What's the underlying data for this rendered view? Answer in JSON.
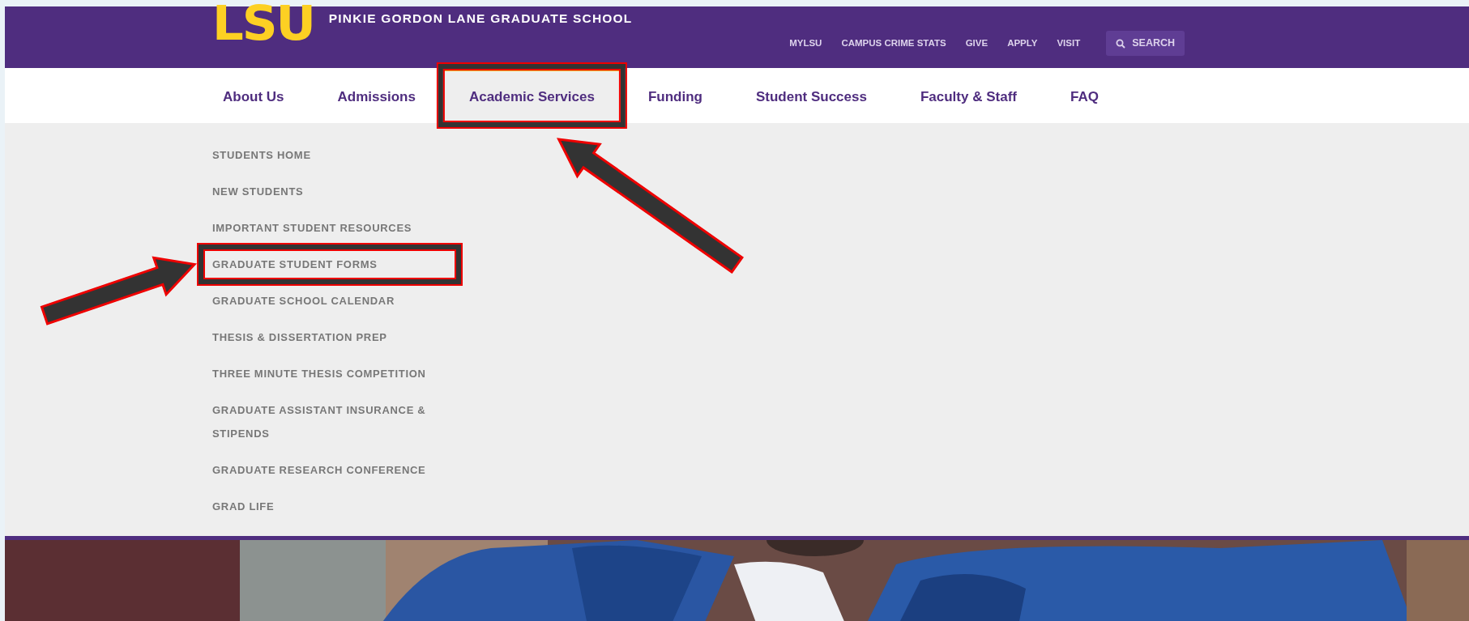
{
  "header": {
    "logo": "LSU",
    "title": "PINKIE GORDON LANE GRADUATE SCHOOL",
    "utility_links": [
      "MYLSU",
      "CAMPUS CRIME STATS",
      "GIVE",
      "APPLY",
      "VISIT"
    ],
    "search": {
      "label": "SEARCH"
    }
  },
  "nav": [
    {
      "label": "About Us",
      "selected": false,
      "highlighted": false
    },
    {
      "label": "Admissions",
      "selected": false,
      "highlighted": false
    },
    {
      "label": "Academic Services",
      "selected": true,
      "highlighted": true
    },
    {
      "label": "Funding",
      "selected": false,
      "highlighted": false
    },
    {
      "label": "Student Success",
      "selected": false,
      "highlighted": false
    },
    {
      "label": "Faculty & Staff",
      "selected": false,
      "highlighted": false
    },
    {
      "label": "FAQ",
      "selected": false,
      "highlighted": false
    }
  ],
  "dropdown": [
    {
      "label": "STUDENTS HOME",
      "highlighted": false
    },
    {
      "label": "NEW STUDENTS",
      "highlighted": false
    },
    {
      "label": "IMPORTANT STUDENT RESOURCES",
      "highlighted": false
    },
    {
      "label": "GRADUATE STUDENT FORMS",
      "highlighted": true
    },
    {
      "label": "GRADUATE SCHOOL CALENDAR",
      "highlighted": false
    },
    {
      "label": "THESIS & DISSERTATION PREP",
      "highlighted": false
    },
    {
      "label": "THREE MINUTE THESIS COMPETITION",
      "highlighted": false
    },
    {
      "label": "GRADUATE ASSISTANT INSURANCE & STIPENDS",
      "highlighted": false
    },
    {
      "label": "GRADUATE RESEARCH CONFERENCE",
      "highlighted": false
    },
    {
      "label": "GRAD LIFE",
      "highlighted": false
    }
  ]
}
